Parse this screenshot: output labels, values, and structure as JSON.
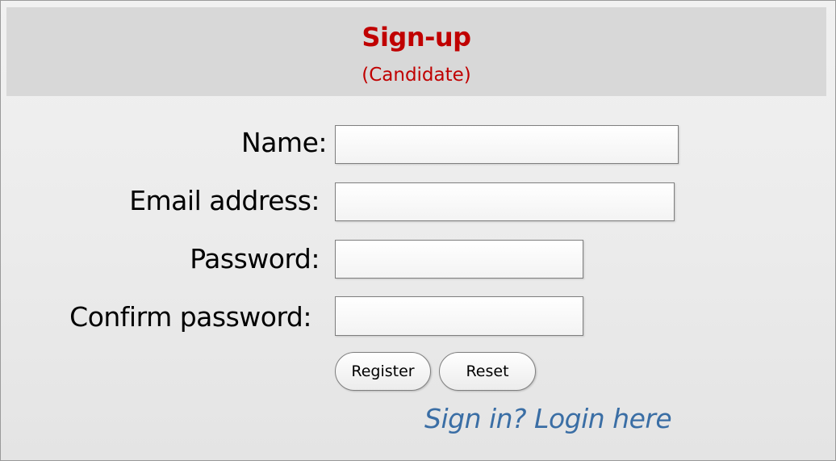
{
  "header": {
    "title": "Sign-up",
    "subtitle": "(Candidate)"
  },
  "form": {
    "name": {
      "label": "Name:",
      "value": ""
    },
    "email": {
      "label": "Email address:",
      "value": ""
    },
    "password": {
      "label": "Password:",
      "value": ""
    },
    "confirm_password": {
      "label": "Confirm password:",
      "value": ""
    }
  },
  "buttons": {
    "register": "Register",
    "reset": "Reset"
  },
  "login_link": "Sign in? Login here",
  "colors": {
    "title": "#c00000",
    "link": "#3a6ea5",
    "header_background": "#d8d8d8"
  }
}
